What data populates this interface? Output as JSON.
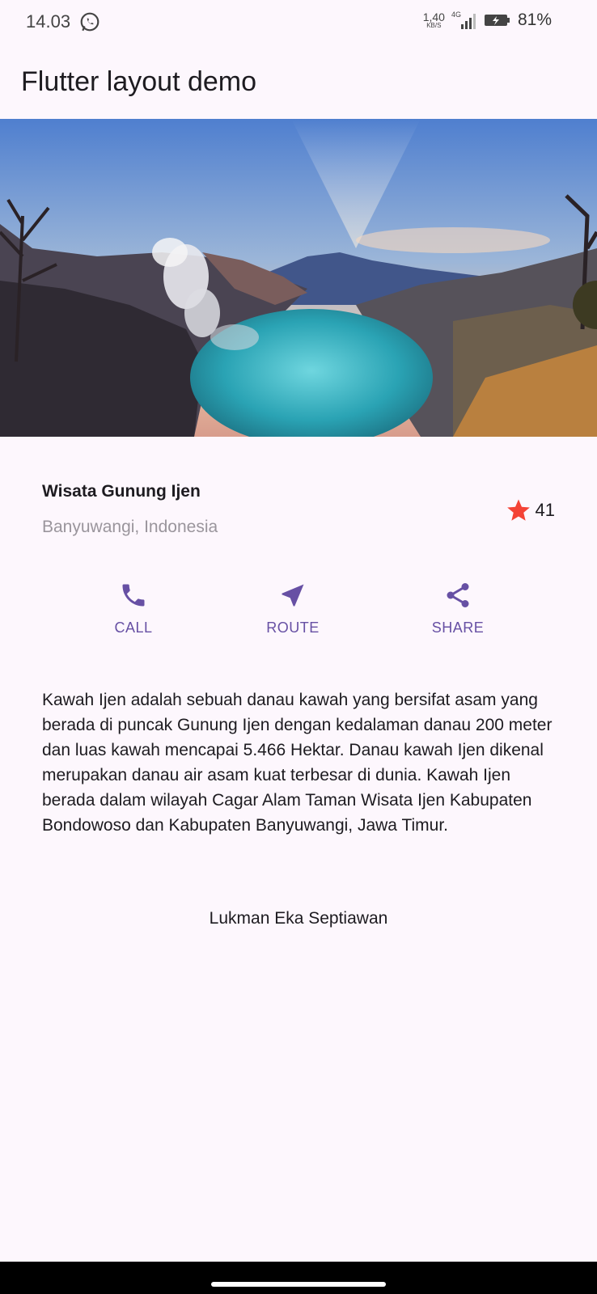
{
  "status_bar": {
    "time": "14.03",
    "net_speed_value": "1,40",
    "net_speed_unit": "KB/S",
    "network_type": "4G",
    "battery_percent": "81%"
  },
  "app_bar": {
    "title": "Flutter layout demo"
  },
  "hero": {
    "icon": "landscape-photo"
  },
  "place": {
    "name": "Wisata Gunung Ijen",
    "location": "Banyuwangi, Indonesia",
    "rating_count": "41",
    "star_color": "#f44336"
  },
  "actions": {
    "accent_color": "#6750a4",
    "call_label": "CALL",
    "route_label": "ROUTE",
    "share_label": "SHARE"
  },
  "description": "Kawah Ijen adalah sebuah danau kawah yang bersifat asam yang berada di puncak Gunung Ijen dengan kedalaman danau 200 meter dan luas kawah mencapai 5.466 Hektar. Danau kawah Ijen dikenal merupakan danau air asam kuat terbesar di dunia. Kawah Ijen berada dalam wilayah Cagar Alam Taman Wisata Ijen Kabupaten Bondowoso dan Kabupaten Banyuwangi, Jawa Timur.",
  "author": "Lukman Eka Septiawan"
}
